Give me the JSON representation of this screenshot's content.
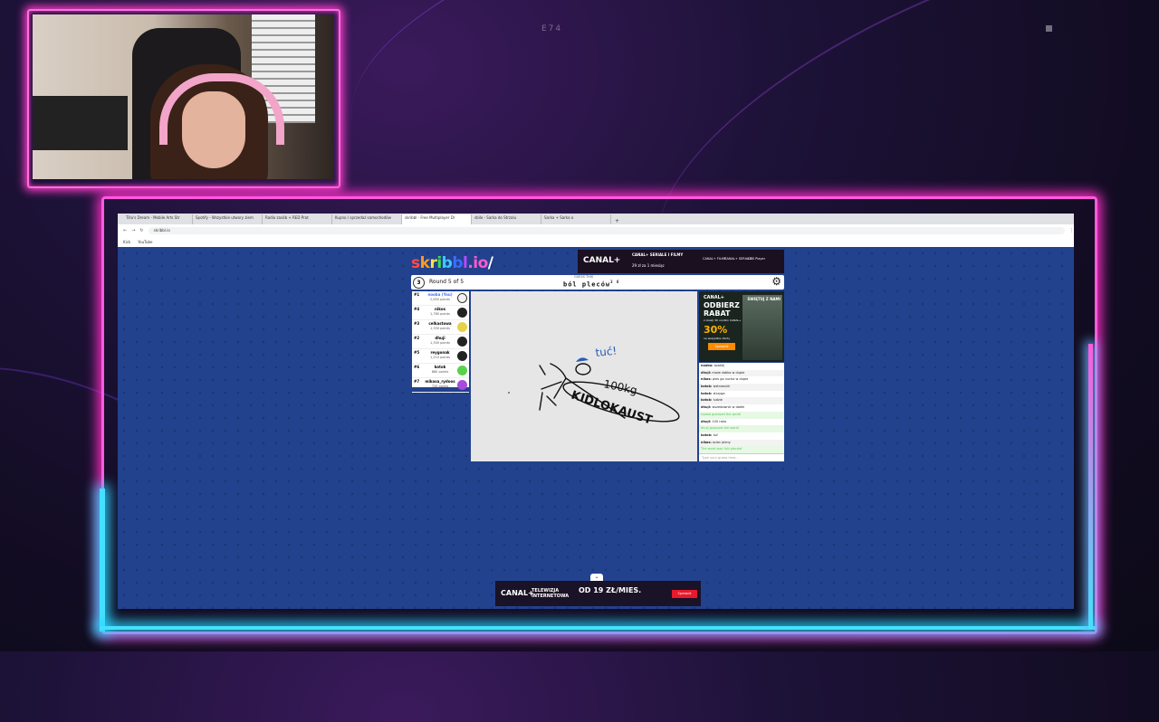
{
  "stream": {
    "hud_center": "E74",
    "webcam_label": "streamer webcam"
  },
  "browser": {
    "tabs": [
      {
        "label": "Tillu's Dream - Mobile Arts Str"
      },
      {
        "label": "Spotify - Wszystkie utwory ziem"
      },
      {
        "label": "Radio zasób + RED Prat"
      },
      {
        "label": "Kupno / sprzedaż samochodów"
      },
      {
        "label": "skribbl - Free Multiplayer Dr",
        "active": true
      },
      {
        "label": "sbilo - Sarka do Strzalu"
      },
      {
        "label": "Sarka + Sarka o"
      }
    ],
    "url": "skribbl.io",
    "bookmarks": [
      "Kick",
      "YouTube"
    ]
  },
  "game": {
    "logo_letters": [
      "s",
      "k",
      "r",
      "i",
      "b",
      "b",
      "l",
      ".io",
      "/"
    ],
    "round_label": "Round 5 of 5",
    "timer": "3",
    "guess_label": "GUESS THIS",
    "word": "ból pleców",
    "word_length": "3 6",
    "players": [
      {
        "rank": "#1",
        "name": "nooba (You)",
        "points": "2,650 points",
        "avatar_color": "#f2f2f2",
        "self": true
      },
      {
        "rank": "#4",
        "name": "nikos",
        "points": "1,780 points",
        "avatar_color": "#222222"
      },
      {
        "rank": "#3",
        "name": "celkastowa",
        "points": "1,350 points",
        "avatar_color": "#e8d14a"
      },
      {
        "rank": "#2",
        "name": "dhuji",
        "points": "1,300 points",
        "avatar_color": "#222222"
      },
      {
        "rank": "#5",
        "name": "reygonak",
        "points": "1,210 points",
        "avatar_color": "#222222"
      },
      {
        "rank": "#6",
        "name": "kotok",
        "points": "880 points",
        "avatar_color": "#57d24a"
      },
      {
        "rank": "#7",
        "name": "mikasa_rydoos",
        "points": "720 points",
        "avatar_color": "#a64ae0"
      }
    ],
    "drawing_text": {
      "top": "tuć!",
      "weight": "100kg",
      "body": "KIDLOKAUST"
    },
    "chat": [
      {
        "who": "nooba:",
        "text": "spokój",
        "green": false
      },
      {
        "who": "dhuji:",
        "text": "może żabka w dupie",
        "green": false
      },
      {
        "who": "nikos:",
        "text": "pies go nucha w dupie",
        "green": false
      },
      {
        "who": "kotok:",
        "text": "wstrzasnik",
        "green": false
      },
      {
        "who": "kotok:",
        "text": "strzyga",
        "green": false
      },
      {
        "who": "kotok:",
        "text": "ludzie",
        "green": false
      },
      {
        "who": "dhuji:",
        "text": "wszedownik w dołek",
        "green": false
      },
      {
        "who": "",
        "text": "nooba guessed the word!",
        "green": true
      },
      {
        "who": "dhuji:",
        "text": "100 raka",
        "green": false
      },
      {
        "who": "",
        "text": "dhuji guessed the word!",
        "green": true
      },
      {
        "who": "kotok:",
        "text": "tuć",
        "green": false
      },
      {
        "who": "nikos:",
        "text": "ociec pleny",
        "green": false
      },
      {
        "who": "",
        "text": "The word was 'ból pleców'",
        "green": true
      }
    ],
    "chat_placeholder": "Type your guess here..."
  },
  "ads": {
    "top": {
      "brand": "CANAL+",
      "line1": "CANAL+ SERIALE I FILMY",
      "line2": "29 zł za 1 miesiąc",
      "chips": [
        "CANAL+ FILMY",
        "CANAL+ SERIALE",
        "CBS Player"
      ]
    },
    "side": {
      "brand": "CANAL+",
      "headline": "ODBIERZ RABAT",
      "sub": "z okazji 30 urodzin CANAL+",
      "percent": "30%",
      "fine": "na wszystkie oferty",
      "cta": "Sprawdź",
      "tag": "ŚWIĘTUJ Z NAMI"
    },
    "bottom": {
      "brand": "CANAL+",
      "line": "TELEWIZJA INTERNETOWA",
      "price": "OD 19 ZŁ/MIES.",
      "cta": "Sprawdź",
      "collapse": "⌄"
    }
  },
  "colors": {
    "neon_pink": "#ff3ecb",
    "neon_blue": "#2bd4ff",
    "page_bg": "#22428e"
  }
}
